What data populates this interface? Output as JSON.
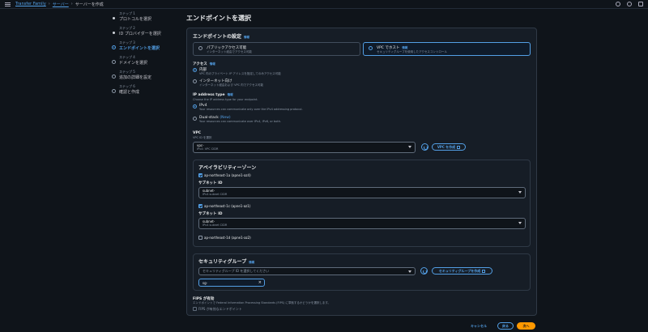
{
  "breadcrumb": {
    "service": "Transfer Family",
    "servers": "サーバー",
    "current": "サーバーを作成"
  },
  "steps": [
    {
      "num": "ステップ 1",
      "label": "プロトコルを選択"
    },
    {
      "num": "ステップ 2",
      "label": "ID プロバイダーを選択"
    },
    {
      "num": "ステップ 3",
      "label": "エンドポイントを選択"
    },
    {
      "num": "ステップ 4",
      "label": "ドメインを選択"
    },
    {
      "num": "ステップ 5",
      "label": "追加の詳細を設定"
    },
    {
      "num": "ステップ 6",
      "label": "確認と作成"
    }
  ],
  "page_title": "エンドポイントを選択",
  "endpoint": {
    "heading": "エンドポイントの設定",
    "info": "情報",
    "public": {
      "title": "パブリックアクセス可能",
      "desc": "インターネット経由でアクセス可能"
    },
    "vpc": {
      "title": "VPC でホスト",
      "badge": "情報",
      "desc": "セキュリティグループを使用したアクセスコントロール"
    }
  },
  "access": {
    "label": "アクセス",
    "info": "情報",
    "internal": {
      "title": "内部",
      "desc": "VPC 内のプライベート IP アドレスを指定してのみアクセス可能"
    },
    "internet": {
      "title": "インターネット向け",
      "desc": "インターネット経由および VPC 内でアクセス可能"
    }
  },
  "ip": {
    "label": "IP address type",
    "info": "情報",
    "desc": "Choose the IP address type for your endpoint.",
    "ipv4": {
      "title": "IPv4",
      "desc": "Your resources can communicate only over the IPv4 addressing protocol."
    },
    "dual": {
      "title": "Dual-stack",
      "badge": "(New)",
      "desc": "Your resources can communicate over IPv4, IPv6, or both."
    }
  },
  "vpc": {
    "label": "VPC",
    "desc": "VPC ID を選択",
    "value": "vpc-",
    "sub": "IPv4: VPC CIDR",
    "create": "VPC を作成"
  },
  "az": {
    "heading": "アベイラビリティーゾーン",
    "zones": [
      {
        "name": "ap-northeast-1a (apne1-az4)",
        "checked": true,
        "subnet_label": "サブネット ID",
        "subnet": "subnet-",
        "cidr": "IPv4 subnet CIDR"
      },
      {
        "name": "ap-northeast-1c (apne1-az1)",
        "checked": true,
        "subnet_label": "サブネット ID",
        "subnet": "subnet-",
        "cidr": "IPv4 subnet CIDR"
      },
      {
        "name": "ap-northeast-1d (apne1-az2)",
        "checked": false
      }
    ]
  },
  "sg": {
    "heading": "セキュリティグループ",
    "info": "情報",
    "placeholder": "セキュリティグループ ID を選択してください",
    "create": "セキュリティグループを作成",
    "token": "sg-"
  },
  "fips": {
    "label": "FIPS が有効",
    "desc": "エンドポイントで Federal Information Processing Standards (FIPS) に準拠するかどうかを選択します。",
    "option": "FIPS が有効なエンドポイント"
  },
  "footer": {
    "cancel": "キャンセル",
    "back": "戻る",
    "next": "次へ"
  },
  "colors": {
    "accent": "#539fe5",
    "primary": "#ff9900",
    "bg": "#0f141a",
    "panel": "#161d26"
  }
}
